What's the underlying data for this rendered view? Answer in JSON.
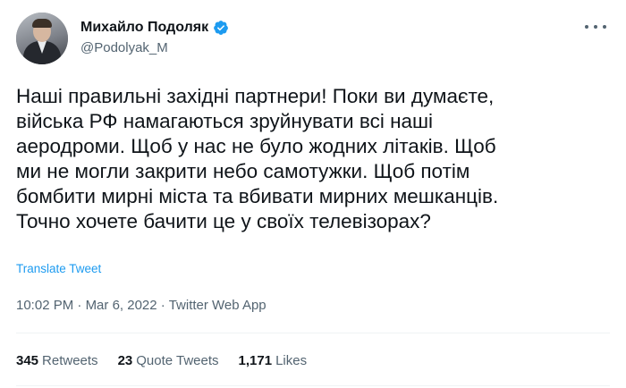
{
  "author": {
    "display_name": "Михайло Подоляк",
    "handle": "@Podolyak_M",
    "verified": true
  },
  "tweet": {
    "text": "Наші правильні західні партнери! Поки ви думаєте,\nвійська РФ намагаються зруйнувати всі наші\nаеродроми. Щоб у нас не було жодних літаків. Щоб\nми не могли закрити небо самотужки. Щоб потім\nбомбити мирні міста та вбивати мирних мешканців.\nТочно хочете бачити це у своїх телевізорах?",
    "translate_label": "Translate Tweet",
    "time": "10:02 PM",
    "separator": "·",
    "date": "Mar 6, 2022",
    "source": "Twitter Web App"
  },
  "stats": {
    "retweets_count": "345",
    "retweets_label": "Retweets",
    "quote_count": "23",
    "quote_label": "Quote Tweets",
    "likes_count": "1,171",
    "likes_label": "Likes"
  },
  "colors": {
    "accent": "#1d9bf0",
    "text_primary": "#0f1419",
    "text_secondary": "#536471",
    "divider": "#eff3f4"
  },
  "icons": {
    "verified": "verified-badge-icon",
    "more": "more-options-icon"
  }
}
